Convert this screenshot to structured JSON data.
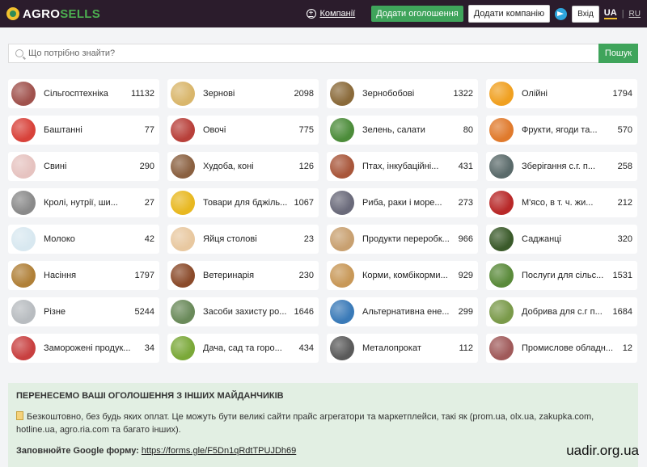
{
  "header": {
    "logo_agro": "AGRO",
    "logo_sells": "SELLS",
    "companies_link": "Компанії",
    "add_listing": "Додати оголошення",
    "add_company": "Додати компанію",
    "login": "Вхід",
    "lang_ua": "UA",
    "lang_ru": "RU"
  },
  "search": {
    "placeholder": "Що потрібно знайти?",
    "button": "Пошук"
  },
  "categories": [
    {
      "label": "Сільгосптехніка",
      "count": "11132",
      "color": "#a0524d"
    },
    {
      "label": "Зернові",
      "count": "2098",
      "color": "#d9b66b"
    },
    {
      "label": "Зернобобові",
      "count": "1322",
      "color": "#8a6a3a"
    },
    {
      "label": "Олійні",
      "count": "1794",
      "color": "#f0a020"
    },
    {
      "label": "Баштанні",
      "count": "77",
      "color": "#d8423a"
    },
    {
      "label": "Овочі",
      "count": "775",
      "color": "#b8403a"
    },
    {
      "label": "Зелень, салати",
      "count": "80",
      "color": "#4c8c3a"
    },
    {
      "label": "Фрукти, ягоди та...",
      "count": "570",
      "color": "#e07a2c"
    },
    {
      "label": "Свині",
      "count": "290",
      "color": "#e6c3c0"
    },
    {
      "label": "Худоба, коні",
      "count": "126",
      "color": "#8a6040"
    },
    {
      "label": "Птах, інкубаційні...",
      "count": "431",
      "color": "#a8563a"
    },
    {
      "label": "Зберігання с.г. п...",
      "count": "258",
      "color": "#5a6a6a"
    },
    {
      "label": "Кролі, нутрії, ши...",
      "count": "27",
      "color": "#8a8a8a"
    },
    {
      "label": "Товари для бджіль...",
      "count": "1067",
      "color": "#e8b820"
    },
    {
      "label": "Риба, раки і море...",
      "count": "273",
      "color": "#6a6a7a"
    },
    {
      "label": "М'ясо, в т. ч. жи...",
      "count": "212",
      "color": "#b82828"
    },
    {
      "label": "Молоко",
      "count": "42",
      "color": "#d8e8f0"
    },
    {
      "label": "Яйця столові",
      "count": "23",
      "color": "#e8c8a0"
    },
    {
      "label": "Продукти переробк...",
      "count": "966",
      "color": "#c8a070"
    },
    {
      "label": "Саджанці",
      "count": "320",
      "color": "#3a5a2a"
    },
    {
      "label": "Насіння",
      "count": "1797",
      "color": "#b08038"
    },
    {
      "label": "Ветеринарія",
      "count": "230",
      "color": "#8a4a2a"
    },
    {
      "label": "Корми, комбікорми...",
      "count": "929",
      "color": "#c89858"
    },
    {
      "label": "Послуги для сільс...",
      "count": "1531",
      "color": "#5a8a3a"
    },
    {
      "label": "Різне",
      "count": "5244",
      "color": "#b8bcc0"
    },
    {
      "label": "Засоби захисту ро...",
      "count": "1646",
      "color": "#6a8a5a"
    },
    {
      "label": "Альтернативна ене...",
      "count": "299",
      "color": "#3a7ab8"
    },
    {
      "label": "Добрива для с.г п...",
      "count": "1684",
      "color": "#7a9a4a"
    },
    {
      "label": "Заморожені продук...",
      "count": "34",
      "color": "#c84040"
    },
    {
      "label": "Дача, сад та горо...",
      "count": "434",
      "color": "#7aa838"
    },
    {
      "label": "Металопрокат",
      "count": "112",
      "color": "#5a5a5a"
    },
    {
      "label": "Промислове обладн...",
      "count": "12",
      "color": "#a05a5a"
    }
  ],
  "info": {
    "title": "ПЕРЕНЕСЕМО ВАШІ ОГОЛОШЕННЯ З ІНШИХ МАЙДАНЧИКІВ",
    "text": "Безкоштовно, без будь яких оплат. Це можуть бути великі сайти прайс агрегатори та маркетплейси, такі як (prom.ua, olx.ua, zakupka.com, hotline.ua, agro.ria.com та багато інших).",
    "form_label": "Заповнюйте Google форму:",
    "form_link": "https://forms.gle/F5Dn1qRdtTPUJDh69"
  },
  "watermark": "uadir.org.ua"
}
